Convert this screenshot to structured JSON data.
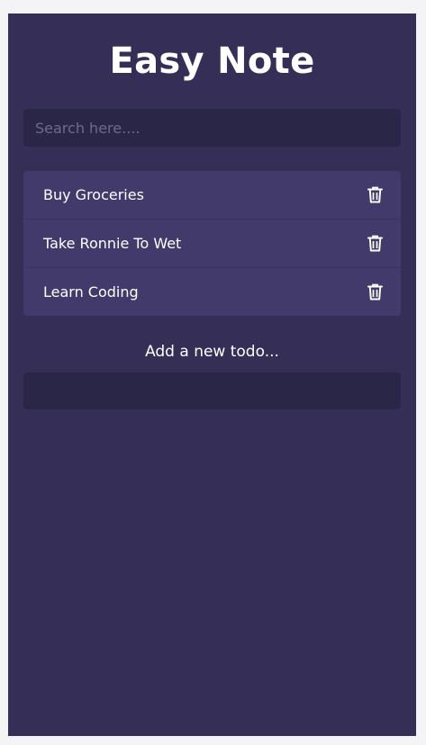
{
  "app": {
    "title": "Easy Note"
  },
  "search": {
    "placeholder": "Search here....",
    "value": ""
  },
  "todos": [
    {
      "label": "Buy Groceries",
      "icon": "trash-icon"
    },
    {
      "label": "Take Ronnie To Wet",
      "icon": "trash-icon"
    },
    {
      "label": "Learn Coding",
      "icon": "trash-icon"
    }
  ],
  "add": {
    "label": "Add a new todo...",
    "value": ""
  },
  "colors": {
    "background": "#352f58",
    "item_background": "#433a6c",
    "input_background": "#2a2647",
    "text": "#ffffff",
    "placeholder": "#6f6b87"
  }
}
